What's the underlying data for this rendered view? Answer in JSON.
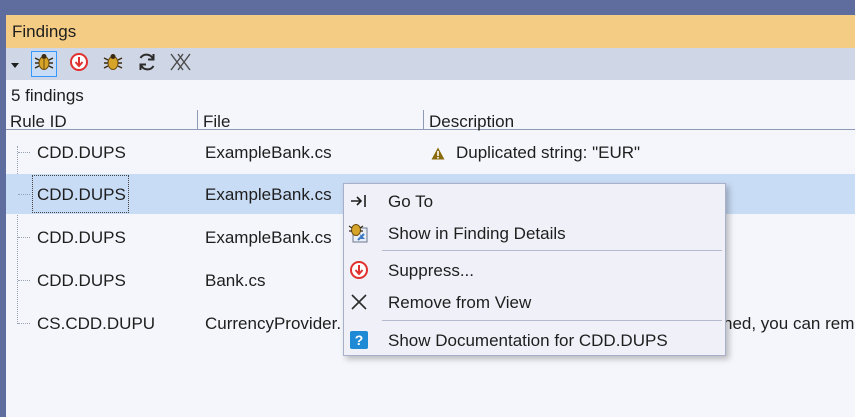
{
  "panel": {
    "title": "Findings"
  },
  "toolbar": {
    "icons": [
      "dropdown-arrow-icon",
      "bug-icon",
      "suppress-icon",
      "bug-icon",
      "refresh-icon",
      "clear-icon"
    ]
  },
  "summary": {
    "count_text": "5 findings"
  },
  "columns": {
    "rule": "Rule ID",
    "file": "File",
    "description": "Description"
  },
  "rows": [
    {
      "rule": "CDD.DUPS",
      "file": "ExampleBank.cs",
      "description": "Duplicated string: \"EUR\""
    },
    {
      "rule": "CDD.DUPS",
      "file": "ExampleBank.cs",
      "description": ""
    },
    {
      "rule": "CDD.DUPS",
      "file": "ExampleBank.cs",
      "description": ""
    },
    {
      "rule": "CDD.DUPS",
      "file": "Bank.cs",
      "description": ""
    },
    {
      "rule": "CS.CDD.DUPU",
      "file": "CurrencyProvider.",
      "description": "ned, you can rem"
    }
  ],
  "context_menu": {
    "items": [
      {
        "label": "Go To",
        "icon": "go-to-icon"
      },
      {
        "label": "Show in Finding Details",
        "icon": "finding-details-icon"
      },
      {
        "label": "Suppress...",
        "icon": "suppress-icon"
      },
      {
        "label": "Remove from View",
        "icon": "close-icon"
      },
      {
        "label": "Show Documentation for CDD.DUPS",
        "icon": "help-icon"
      }
    ]
  },
  "colors": {
    "accent_title": "#f5cc84",
    "selection": "#c9dcf5",
    "frame": "#5e6c9e"
  }
}
